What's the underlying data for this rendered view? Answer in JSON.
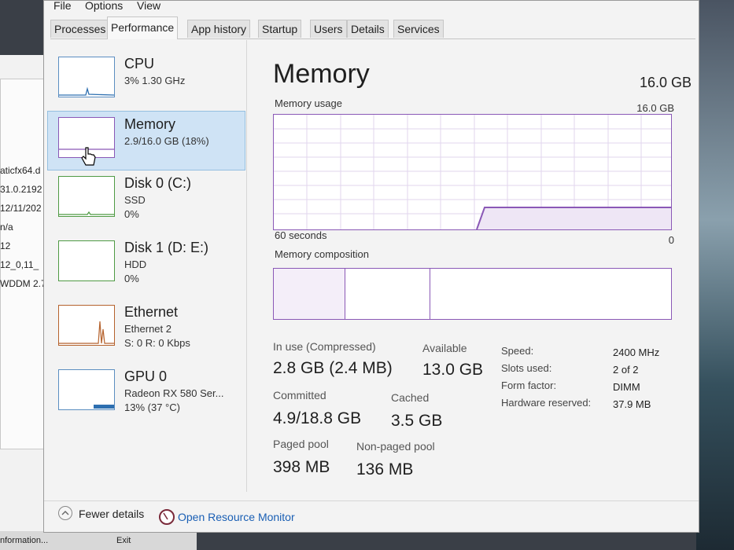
{
  "background": {
    "left_lines": [
      "aticfx64.d",
      "31.0.2192",
      "12/11/202",
      "n/a",
      "12",
      "12_0,11_",
      "WDDM 2.7"
    ],
    "bottom_left": "nformation...",
    "bottom_button": "Exit"
  },
  "menu": {
    "file": "File",
    "options": "Options",
    "view": "View"
  },
  "tabs": [
    "Processes",
    "Performance",
    "App history",
    "Startup",
    "Users",
    "Details",
    "Services"
  ],
  "active_tab": "Performance",
  "sidebar": [
    {
      "title": "CPU",
      "line1": "3% 1.30 GHz",
      "line2": ""
    },
    {
      "title": "Memory",
      "line1": "2.9/16.0 GB (18%)",
      "line2": ""
    },
    {
      "title": "Disk 0 (C:)",
      "line1": "SSD",
      "line2": "0%"
    },
    {
      "title": "Disk 1 (D: E:)",
      "line1": "HDD",
      "line2": "0%"
    },
    {
      "title": "Ethernet",
      "line1": "Ethernet 2",
      "line2": "S: 0 R: 0 Kbps"
    },
    {
      "title": "GPU 0",
      "line1": "Radeon RX 580 Ser...",
      "line2": "13% (37 °C)"
    }
  ],
  "main": {
    "title": "Memory",
    "total": "16.0 GB",
    "usage_label": "Memory usage",
    "usage_max": "16.0 GB",
    "time_label": "60 seconds",
    "min_label": "0",
    "composition_label": "Memory composition",
    "stats": {
      "in_use_label": "In use (Compressed)",
      "in_use_value": "2.8 GB (2.4 MB)",
      "available_label": "Available",
      "available_value": "13.0 GB",
      "committed_label": "Committed",
      "committed_value": "4.9/18.8 GB",
      "cached_label": "Cached",
      "cached_value": "3.5 GB",
      "paged_label": "Paged pool",
      "paged_value": "398 MB",
      "nonpaged_label": "Non-paged pool",
      "nonpaged_value": "136 MB"
    },
    "details": [
      {
        "key": "Speed:",
        "value": "2400 MHz"
      },
      {
        "key": "Slots used:",
        "value": "2 of 2"
      },
      {
        "key": "Form factor:",
        "value": "DIMM"
      },
      {
        "key": "Hardware reserved:",
        "value": "37.9 MB"
      }
    ]
  },
  "footer": {
    "fewer_details": "Fewer details",
    "open_resource_monitor": "Open Resource Monitor"
  },
  "colors": {
    "memory_accent": "#8a58b6",
    "selected_bg": "#cfe3f5",
    "link": "#1a5fb4"
  }
}
